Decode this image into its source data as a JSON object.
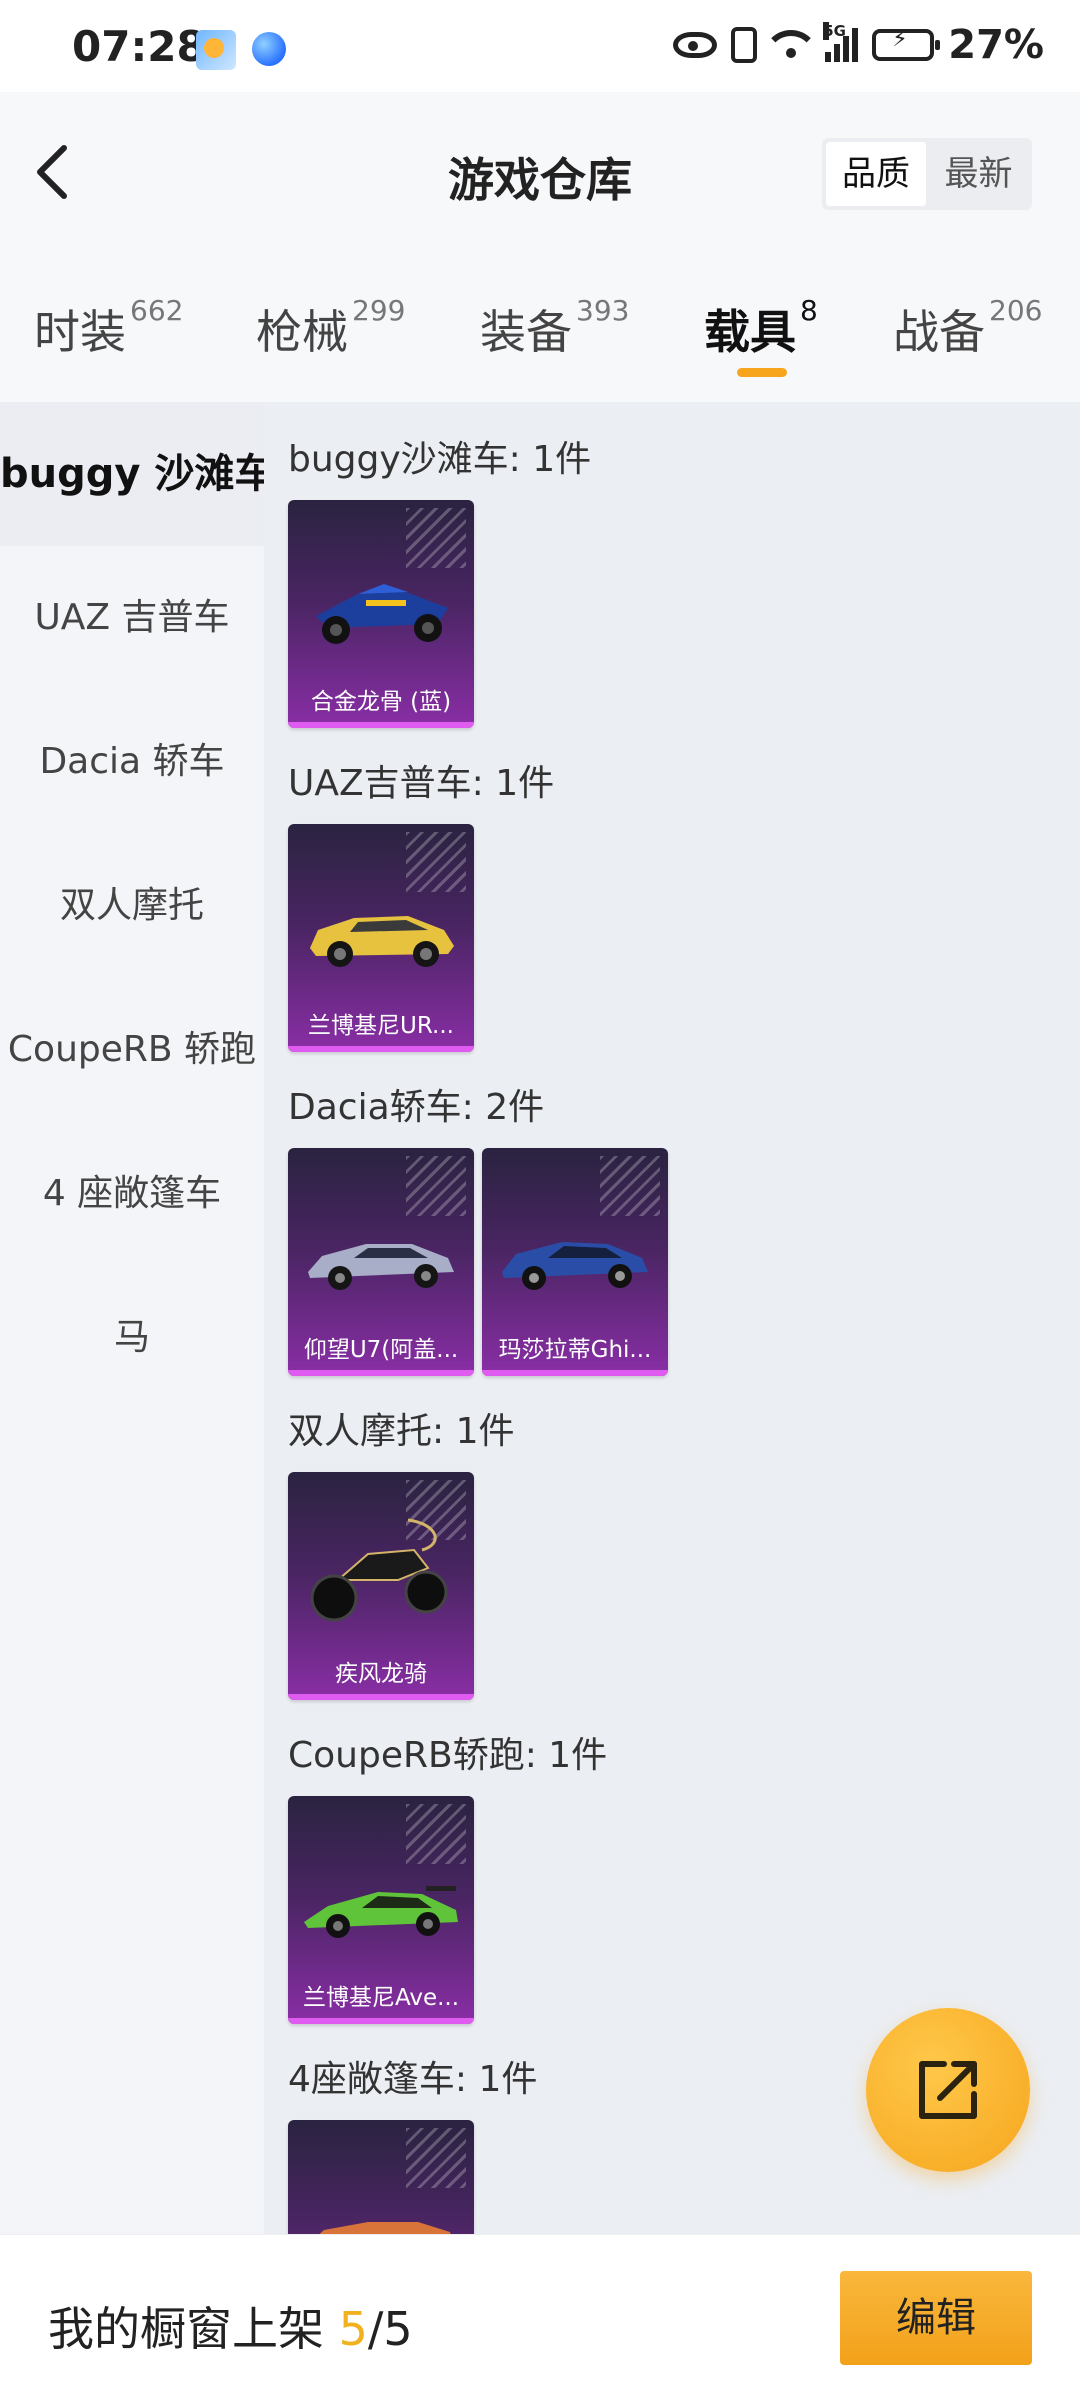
{
  "status_bar": {
    "time": "07:28",
    "network": "5G",
    "battery": "27%",
    "icons": [
      "weather-icon",
      "browser-icon",
      "eye-icon",
      "vibrate-icon",
      "wifi-icon",
      "signal-icon",
      "battery-icon"
    ]
  },
  "header": {
    "title": "游戏仓库",
    "sort_options": [
      "品质",
      "最新"
    ],
    "selected_sort": "品质"
  },
  "tabs": [
    {
      "label": "时装",
      "count": "662"
    },
    {
      "label": "枪械",
      "count": "299"
    },
    {
      "label": "装备",
      "count": "393"
    },
    {
      "label": "载具",
      "count": "8"
    },
    {
      "label": "战备",
      "count": "206"
    }
  ],
  "active_tab": "载具",
  "sidebar": {
    "items": [
      "buggy 沙滩车",
      "UAZ 吉普车",
      "Dacia 轿车",
      "双人摩托",
      "CoupeRB 轿跑",
      "4 座敞篷车",
      "马"
    ],
    "active": "buggy 沙滩车"
  },
  "sections": [
    {
      "title": "buggy沙滩车: 1件",
      "items": [
        "合金龙骨 (蓝)"
      ]
    },
    {
      "title": "UAZ吉普车: 1件",
      "items": [
        "兰博基尼UR..."
      ]
    },
    {
      "title": "Dacia轿车: 2件",
      "items": [
        "仰望U7(阿盖...",
        "玛莎拉蒂Ghi..."
      ]
    },
    {
      "title": "双人摩托: 1件",
      "items": [
        "疾风龙骑"
      ]
    },
    {
      "title": "CoupeRB轿跑: 1件",
      "items": [
        "兰博基尼Ave..."
      ]
    },
    {
      "title": "4座敞篷车: 1件",
      "items": []
    }
  ],
  "bottom_bar": {
    "label": "我的橱窗上架 ",
    "count_current": "5",
    "count_total": "/5",
    "edit_label": "编辑"
  },
  "colors": {
    "accent": "#f6a51c",
    "card_purple": "#8a2ea6",
    "card_edge": "#e05cf0"
  }
}
